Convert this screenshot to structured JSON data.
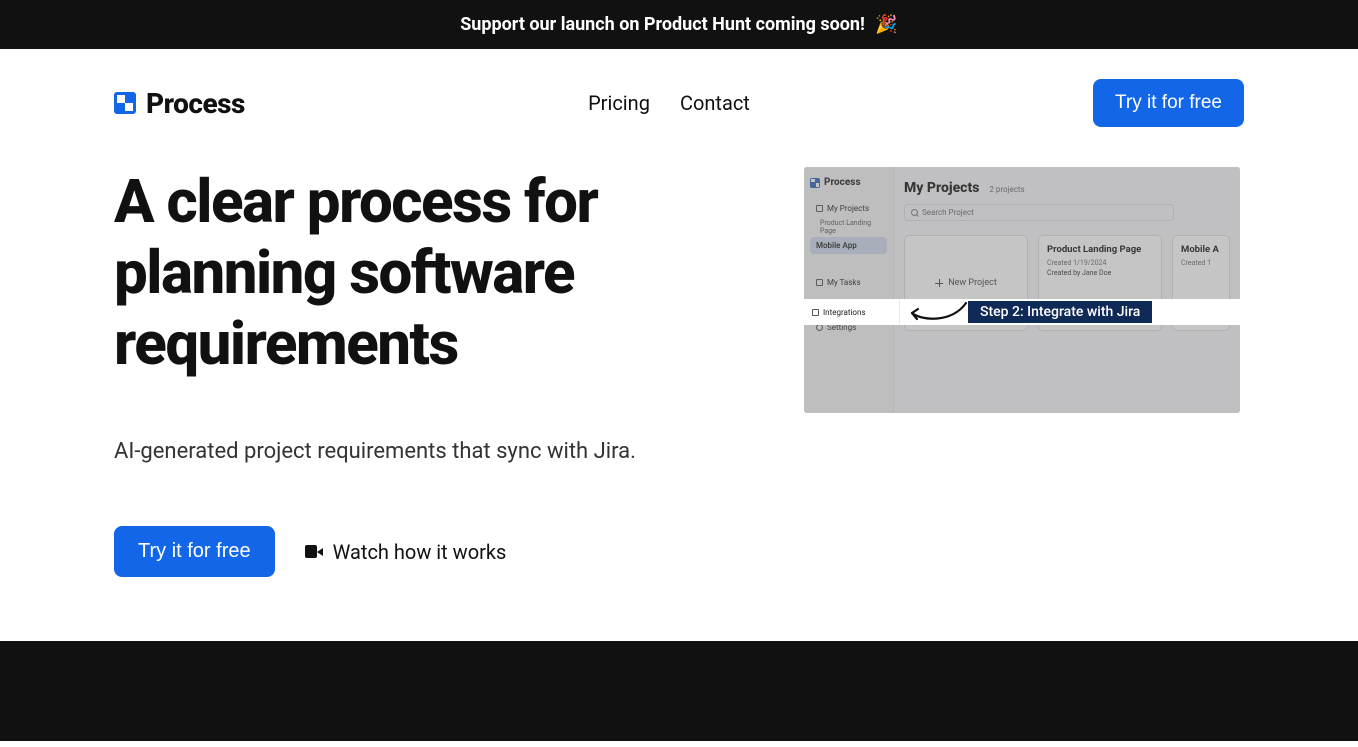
{
  "announcement": {
    "text": "Support our launch on Product Hunt coming soon!",
    "emoji": "🎉"
  },
  "brand": {
    "name": "Process"
  },
  "nav": {
    "pricing": "Pricing",
    "contact": "Contact"
  },
  "header": {
    "cta": "Try it for free"
  },
  "hero": {
    "headline": "A clear process for planning software requirements",
    "subhead": "AI-generated project requirements that sync with Jira.",
    "primary_cta": "Try it for free",
    "watch_label": "Watch how it works"
  },
  "demo": {
    "brand": "Process",
    "sidebar": {
      "my_projects": "My Projects",
      "sub_items": [
        "Product Landing Page",
        "Mobile App"
      ],
      "my_tasks": "My Tasks",
      "integrations": "Integrations",
      "settings": "Settings"
    },
    "main": {
      "title": "My Projects",
      "count": "2 projects",
      "search_placeholder": "Search Project",
      "new_project": "New Project",
      "cards": [
        {
          "title": "Product Landing Page",
          "created": "Created 1/19/2024",
          "author": "Created by Jane Doe"
        },
        {
          "title": "Mobile A",
          "created": "Created 1"
        }
      ]
    },
    "step": {
      "sidebar_item": "Integrations",
      "label": "Step 2: Integrate with Jira"
    }
  }
}
